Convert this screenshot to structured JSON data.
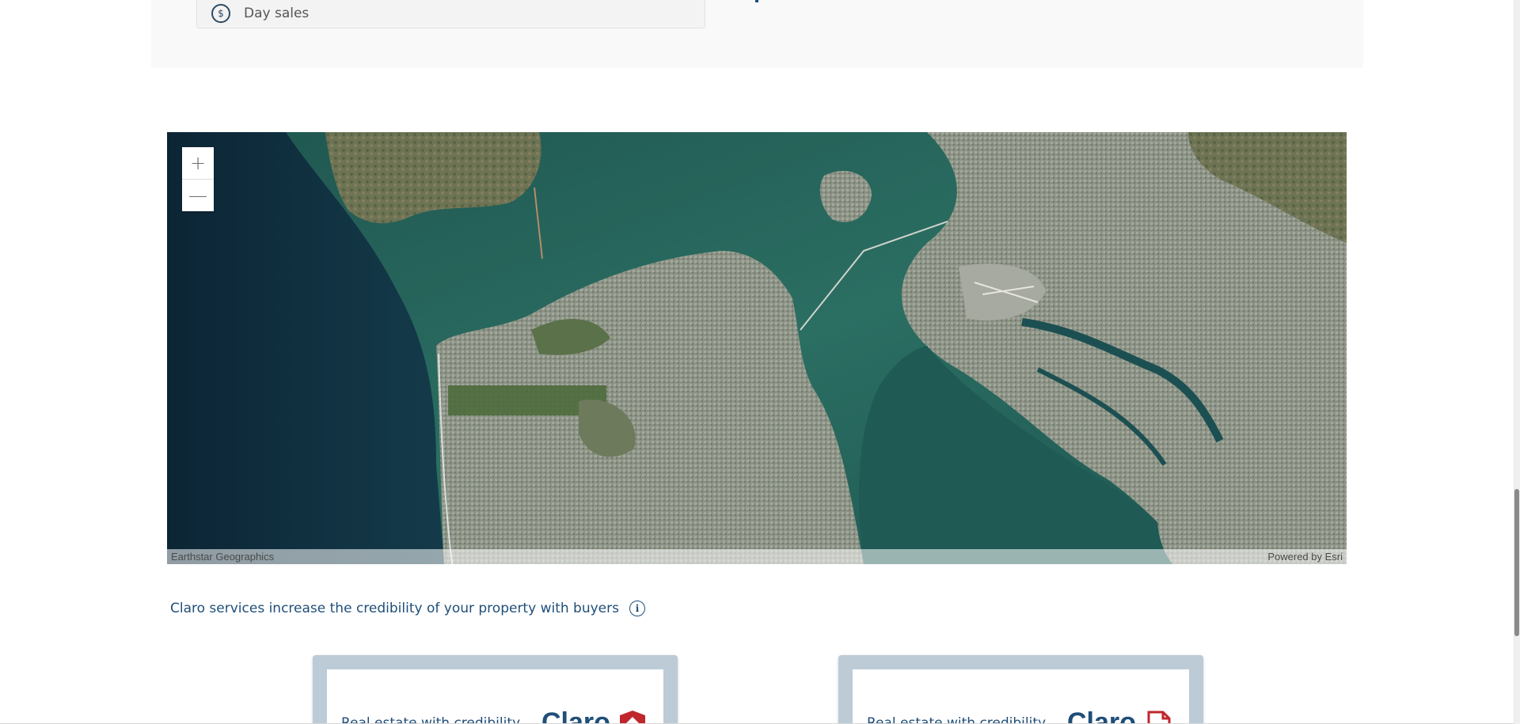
{
  "top_panel": {
    "day_sales_label": "Day sales",
    "day_sales_icon": "hand-coin-icon"
  },
  "map": {
    "zoom_in_label": "+",
    "zoom_out_label": "—",
    "attribution_left": "Earthstar Geographics",
    "attribution_right": "Powered by Esri",
    "colors": {
      "ocean": "#0f2e3f",
      "bay": "#27635a",
      "land": "#7d8873"
    }
  },
  "credibility": {
    "text": "Claro services increase the credibility of your property with buyers",
    "info_icon": "i"
  },
  "cards": [
    {
      "text": "Real estate with credibility",
      "brand": "Claro",
      "badge_color": "#c0272d"
    },
    {
      "text": "Real estate with credibility",
      "brand": "Claro",
      "badge_color": "#c0272d"
    }
  ]
}
